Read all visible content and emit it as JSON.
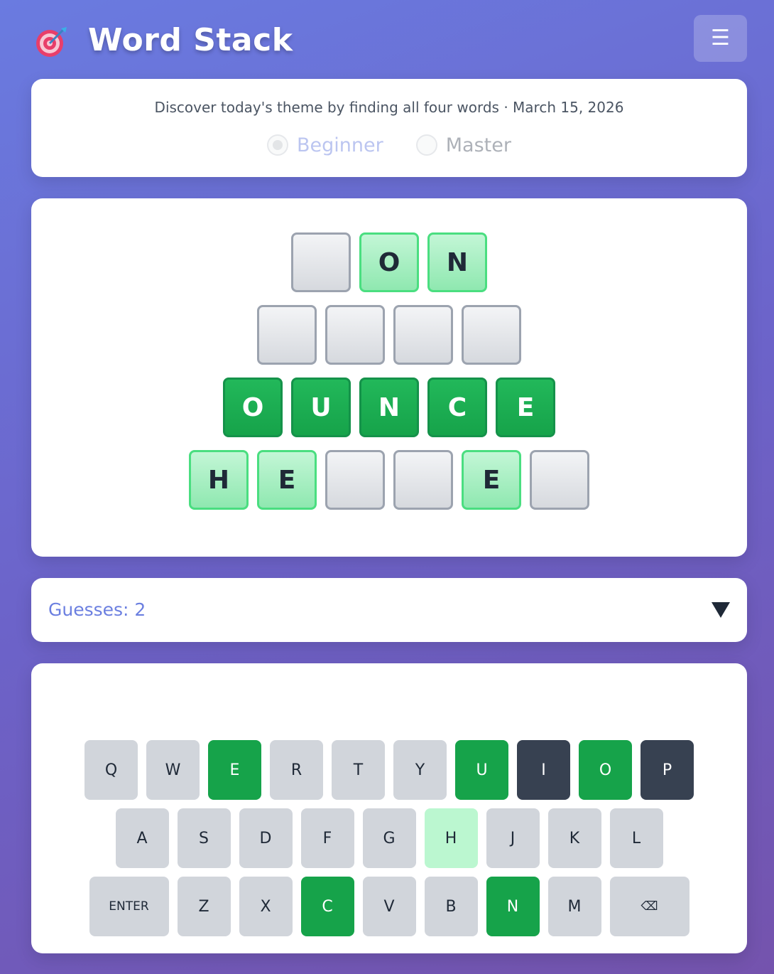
{
  "app": {
    "title": "Word Stack",
    "logo_icon": "dartboard-icon",
    "menu_icon": "☰"
  },
  "info": {
    "subtitle": "Discover today's theme by finding all four words · March 15, 2026",
    "modes": [
      {
        "label": "Beginner",
        "selected": true
      },
      {
        "label": "Master",
        "selected": false
      }
    ]
  },
  "board": {
    "rows": [
      [
        {
          "letter": "",
          "state": "empty"
        },
        {
          "letter": "O",
          "state": "hint"
        },
        {
          "letter": "N",
          "state": "hint"
        }
      ],
      [
        {
          "letter": "",
          "state": "empty"
        },
        {
          "letter": "",
          "state": "empty"
        },
        {
          "letter": "",
          "state": "empty"
        },
        {
          "letter": "",
          "state": "empty"
        }
      ],
      [
        {
          "letter": "O",
          "state": "solved"
        },
        {
          "letter": "U",
          "state": "solved"
        },
        {
          "letter": "N",
          "state": "solved"
        },
        {
          "letter": "C",
          "state": "solved"
        },
        {
          "letter": "E",
          "state": "solved"
        }
      ],
      [
        {
          "letter": "H",
          "state": "hint"
        },
        {
          "letter": "E",
          "state": "hint"
        },
        {
          "letter": "",
          "state": "empty"
        },
        {
          "letter": "",
          "state": "empty"
        },
        {
          "letter": "E",
          "state": "hint"
        },
        {
          "letter": "",
          "state": "empty"
        }
      ]
    ]
  },
  "guesses": {
    "label": "Guesses: 2",
    "toggle_icon": "chevron-down-icon"
  },
  "keyboard": {
    "rows": [
      [
        {
          "key": "Q",
          "state": "default"
        },
        {
          "key": "W",
          "state": "default"
        },
        {
          "key": "E",
          "state": "correct"
        },
        {
          "key": "R",
          "state": "default"
        },
        {
          "key": "T",
          "state": "default"
        },
        {
          "key": "Y",
          "state": "default"
        },
        {
          "key": "U",
          "state": "correct"
        },
        {
          "key": "I",
          "state": "absent"
        },
        {
          "key": "O",
          "state": "correct"
        },
        {
          "key": "P",
          "state": "absent"
        }
      ],
      [
        {
          "key": "A",
          "state": "default"
        },
        {
          "key": "S",
          "state": "default"
        },
        {
          "key": "D",
          "state": "default"
        },
        {
          "key": "F",
          "state": "default"
        },
        {
          "key": "G",
          "state": "default"
        },
        {
          "key": "H",
          "state": "present"
        },
        {
          "key": "J",
          "state": "default"
        },
        {
          "key": "K",
          "state": "default"
        },
        {
          "key": "L",
          "state": "default"
        }
      ],
      [
        {
          "key": "ENTER",
          "state": "default",
          "wide": true
        },
        {
          "key": "Z",
          "state": "default"
        },
        {
          "key": "X",
          "state": "default"
        },
        {
          "key": "C",
          "state": "correct"
        },
        {
          "key": "V",
          "state": "default"
        },
        {
          "key": "B",
          "state": "default"
        },
        {
          "key": "N",
          "state": "correct"
        },
        {
          "key": "M",
          "state": "default"
        },
        {
          "key": "⌫",
          "state": "default",
          "wide": true
        }
      ]
    ]
  },
  "colors": {
    "correct": "#16a34a",
    "hint": "#bbf7d0",
    "absent": "#374151",
    "default_key": "#d1d5db",
    "accent": "#6b7fe0"
  }
}
